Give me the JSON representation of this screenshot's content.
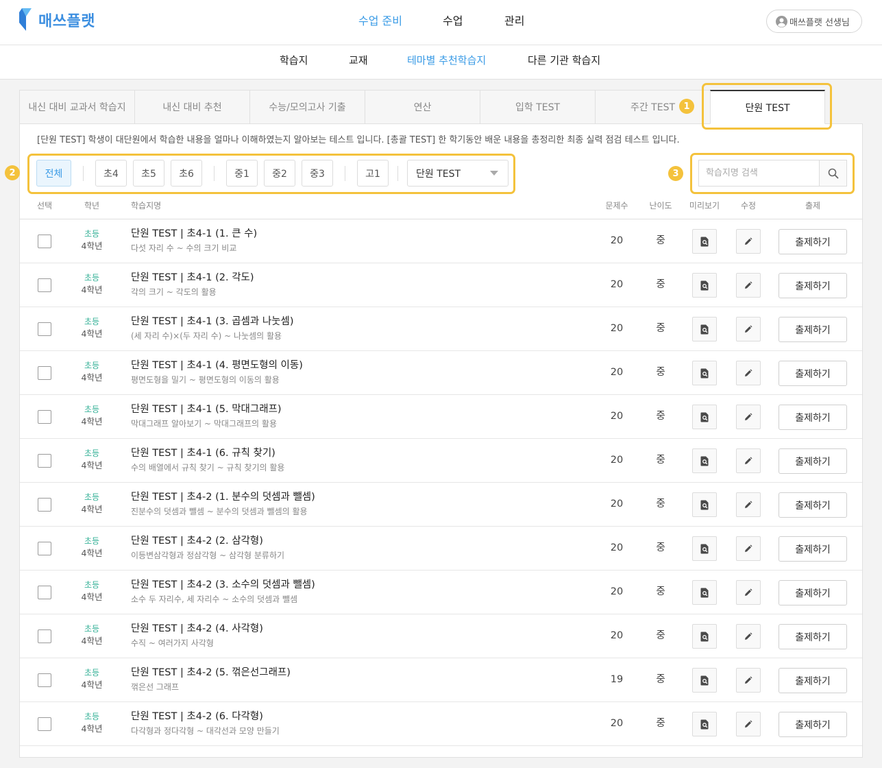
{
  "header": {
    "logo_text": "매쓰플랫",
    "nav": [
      {
        "label": "수업 준비",
        "active": true
      },
      {
        "label": "수업",
        "active": false
      },
      {
        "label": "관리",
        "active": false
      }
    ],
    "user_label": "매쓰플랫 선생님"
  },
  "subnav": [
    {
      "label": "학습지",
      "active": false
    },
    {
      "label": "교재",
      "active": false
    },
    {
      "label": "테마별 추천학습지",
      "active": true
    },
    {
      "label": "다른 기관 학습지",
      "active": false
    }
  ],
  "tabs": [
    {
      "label": "내신 대비 교과서 학습지",
      "active": false
    },
    {
      "label": "내신 대비 추천",
      "active": false
    },
    {
      "label": "수능/모의고사 기출",
      "active": false
    },
    {
      "label": "연산",
      "active": false
    },
    {
      "label": "입학 TEST",
      "active": false
    },
    {
      "label": "주간 TEST",
      "active": false
    },
    {
      "label": "단원 TEST",
      "active": true
    }
  ],
  "description": "[단원 TEST] 학생이 대단원에서 학습한 내용을 얼마나 이해하였는지 알아보는 테스트 입니다. [총괄 TEST] 한 학기동안 배운 내용을 총정리한 최종 실력 점검 테스트 입니다.",
  "filters": {
    "buttons": [
      {
        "label": "전체",
        "active": true
      },
      {
        "label": "초4",
        "active": false
      },
      {
        "label": "초5",
        "active": false
      },
      {
        "label": "초6",
        "active": false
      },
      {
        "label": "중1",
        "active": false
      },
      {
        "label": "중2",
        "active": false
      },
      {
        "label": "중3",
        "active": false
      },
      {
        "label": "고1",
        "active": false
      }
    ],
    "type_select": "단원 TEST"
  },
  "search": {
    "placeholder": "학습지명 검색",
    "value": ""
  },
  "columns": {
    "select": "선택",
    "grade": "학년",
    "title": "학습지명",
    "count": "문제수",
    "difficulty": "난이도",
    "preview": "미리보기",
    "edit": "수정",
    "assign": "출제"
  },
  "row_actions": {
    "assign_label": "출제하기"
  },
  "rows": [
    {
      "level": "초등",
      "grade": "4학년",
      "title": "단원 TEST | 초4-1 (1. 큰 수)",
      "subtitle": "다섯 자리 수 ~ 수의 크기 비교",
      "count": 20,
      "difficulty": "중",
      "checked": false
    },
    {
      "level": "초등",
      "grade": "4학년",
      "title": "단원 TEST | 초4-1 (2. 각도)",
      "subtitle": "각의 크기 ~ 각도의 활용",
      "count": 20,
      "difficulty": "중",
      "checked": false
    },
    {
      "level": "초등",
      "grade": "4학년",
      "title": "단원 TEST | 초4-1 (3. 곱셈과 나눗셈)",
      "subtitle": "(세 자리 수)×(두 자리 수) ~ 나눗셈의 활용",
      "count": 20,
      "difficulty": "중",
      "checked": false
    },
    {
      "level": "초등",
      "grade": "4학년",
      "title": "단원 TEST | 초4-1 (4. 평면도형의 이동)",
      "subtitle": "평면도형을 밀기 ~ 평면도형의 이동의 활용",
      "count": 20,
      "difficulty": "중",
      "checked": false
    },
    {
      "level": "초등",
      "grade": "4학년",
      "title": "단원 TEST | 초4-1 (5. 막대그래프)",
      "subtitle": "막대그래프 알아보기 ~ 막대그래프의 활용",
      "count": 20,
      "difficulty": "중",
      "checked": false
    },
    {
      "level": "초등",
      "grade": "4학년",
      "title": "단원 TEST | 초4-1 (6. 규칙 찾기)",
      "subtitle": "수의 배열에서 규칙 찾기 ~ 규칙 찾기의 활용",
      "count": 20,
      "difficulty": "중",
      "checked": false
    },
    {
      "level": "초등",
      "grade": "4학년",
      "title": "단원 TEST | 초4-2 (1. 분수의 덧셈과 뺄셈)",
      "subtitle": "진분수의 덧셈과 뺄셈 ~ 분수의 덧셈과 뺄셈의 활용",
      "count": 20,
      "difficulty": "중",
      "checked": false
    },
    {
      "level": "초등",
      "grade": "4학년",
      "title": "단원 TEST | 초4-2 (2. 삼각형)",
      "subtitle": "이등변삼각형과 정삼각형 ~ 삼각형 분류하기",
      "count": 20,
      "difficulty": "중",
      "checked": false
    },
    {
      "level": "초등",
      "grade": "4학년",
      "title": "단원 TEST | 초4-2 (3. 소수의 덧셈과 뺄셈)",
      "subtitle": "소수 두 자리수, 세 자리수 ~ 소수의 덧셈과 뺄셈",
      "count": 20,
      "difficulty": "중",
      "checked": false
    },
    {
      "level": "초등",
      "grade": "4학년",
      "title": "단원 TEST | 초4-2 (4. 사각형)",
      "subtitle": "수직 ~ 여러가지 사각형",
      "count": 20,
      "difficulty": "중",
      "checked": false
    },
    {
      "level": "초등",
      "grade": "4학년",
      "title": "단원 TEST | 초4-2 (5. 꺾은선그래프)",
      "subtitle": "꺾은선 그래프",
      "count": 19,
      "difficulty": "중",
      "checked": false
    },
    {
      "level": "초등",
      "grade": "4학년",
      "title": "단원 TEST | 초4-2 (6. 다각형)",
      "subtitle": "다각형과 정다각형 ~ 대각선과 모양 만들기",
      "count": 20,
      "difficulty": "중",
      "checked": false
    }
  ],
  "annotations": [
    "1",
    "2",
    "3"
  ],
  "icons": {
    "logo": "mathflat-logo-icon",
    "user": "user-avatar-icon",
    "dropdown": "chevron-down-icon",
    "search": "search-icon",
    "preview": "preview-icon",
    "edit": "pencil-icon"
  },
  "colors": {
    "accent": "#3a9be6",
    "brand": "#3d8fe0",
    "elementary": "#3bb39a",
    "annotation": "#f4c23c"
  }
}
